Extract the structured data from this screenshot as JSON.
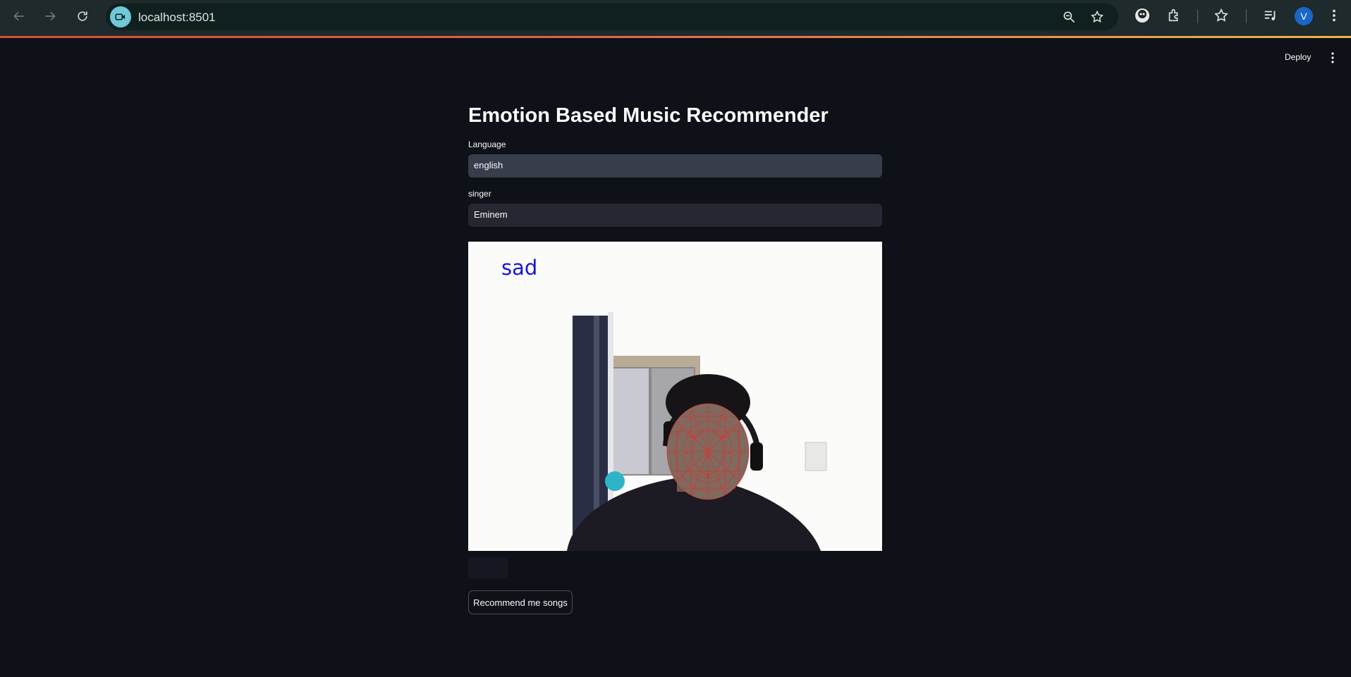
{
  "browser": {
    "url": "localhost:8501",
    "profile_initial": "V",
    "icons": [
      "back-icon",
      "forward-icon",
      "reload-icon",
      "site-camera-icon",
      "zoom-icon",
      "bookmark-star-icon",
      "extension-avatar-icon",
      "extensions-icon",
      "bookmarks-icon",
      "media-control-icon",
      "chrome-menu-icon"
    ]
  },
  "app": {
    "deploy_label": "Deploy",
    "title": "Emotion Based Music Recommender",
    "language_label": "Language",
    "language_value": "english",
    "singer_label": "singer",
    "singer_value": "Eminem",
    "webcam": {
      "emotion_text": "sad"
    },
    "stop_label": "",
    "recommend_label": "Recommend me songs"
  },
  "colors": {
    "background": "#0e1117",
    "chrome": "#1e2a2b",
    "emotion_text": "#1a14d6",
    "face_mesh": "#e03030"
  }
}
